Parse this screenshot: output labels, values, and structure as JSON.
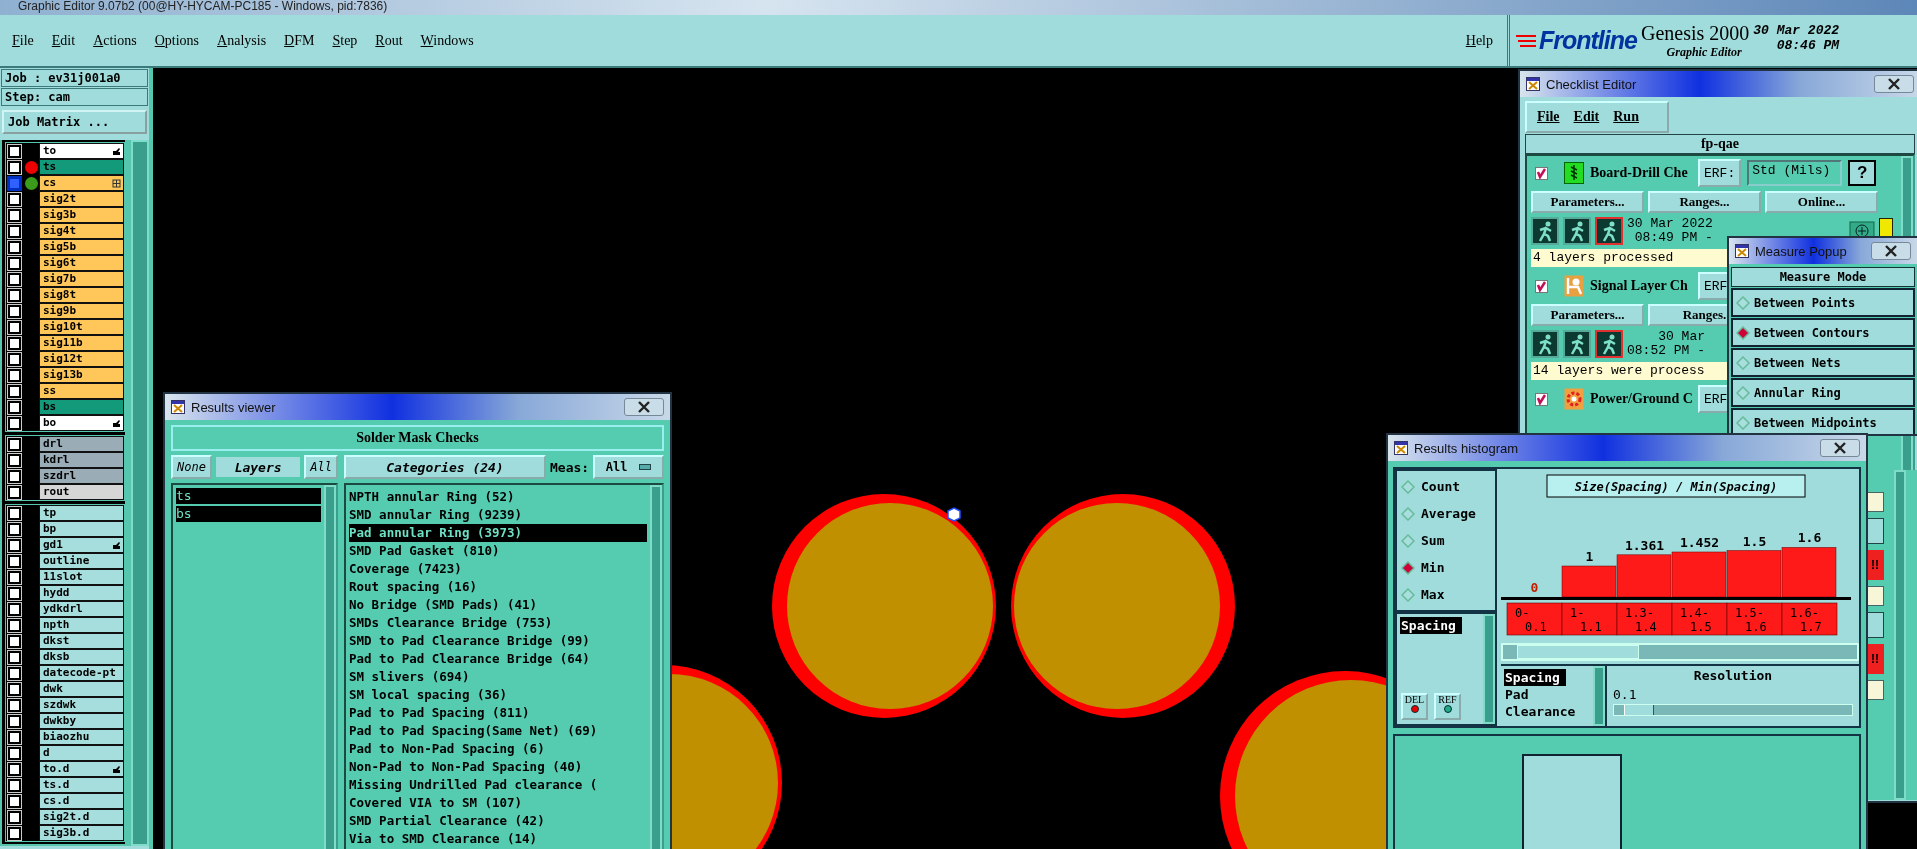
{
  "window": {
    "title": "Graphic Editor 9.07b2 (00@HY-HYCAM-PC185 - Windows, pid:7836)"
  },
  "menu_bar": {
    "items": [
      "File",
      "Edit",
      "Actions",
      "Options",
      "Analysis",
      "DFM",
      "Step",
      "Rout",
      "Windows"
    ],
    "help": "Help"
  },
  "brand": {
    "logo": "Frontline",
    "product": "Genesis 2000",
    "subtitle": "Graphic Editor",
    "date": "30 Mar 2022",
    "time": "08:46 PM"
  },
  "job_panel": {
    "job": "Job : ev31j001a0",
    "step": "Step: cam",
    "job_matrix_button": "Job Matrix ...",
    "layer_groups": [
      {
        "layers": [
          {
            "name": "to",
            "color": "#ffffff",
            "selected": false,
            "marker": {
              "kind": "pointer"
            }
          },
          {
            "name": "ts",
            "color": "#139a7a",
            "selected": false,
            "status_dot": {
              "color": "#ee0000"
            }
          },
          {
            "name": "cs",
            "color": "#ffc65a",
            "selected": true,
            "status_dot": {
              "color": "#3a9a1a"
            },
            "marker": {
              "kind": "grid"
            }
          },
          {
            "name": "sig2t",
            "color": "#ffc65a",
            "selected": false
          },
          {
            "name": "sig3b",
            "color": "#ffc65a",
            "selected": false
          },
          {
            "name": "sig4t",
            "color": "#ffc65a",
            "selected": false
          },
          {
            "name": "sig5b",
            "color": "#ffc65a",
            "selected": false
          },
          {
            "name": "sig6t",
            "color": "#ffc65a",
            "selected": false
          },
          {
            "name": "sig7b",
            "color": "#ffc65a",
            "selected": false
          },
          {
            "name": "sig8t",
            "color": "#ffc65a",
            "selected": false
          },
          {
            "name": "sig9b",
            "color": "#ffc65a",
            "selected": false
          },
          {
            "name": "sig10t",
            "color": "#ffc65a",
            "selected": false
          },
          {
            "name": "sig11b",
            "color": "#ffc65a",
            "selected": false
          },
          {
            "name": "sig12t",
            "color": "#ffc65a",
            "selected": false
          },
          {
            "name": "sig13b",
            "color": "#ffc65a",
            "selected": false
          },
          {
            "name": "ss",
            "color": "#ffc65a",
            "selected": false
          },
          {
            "name": "bs",
            "color": "#139a7a",
            "selected": false
          },
          {
            "name": "bo",
            "color": "#ffffff",
            "selected": false,
            "marker": {
              "kind": "pointer"
            }
          }
        ]
      },
      {
        "layers": [
          {
            "name": "drl",
            "color": "#9aacb6",
            "selected": false
          },
          {
            "name": "kdrl",
            "color": "#9aacb6",
            "selected": false
          },
          {
            "name": "szdrl",
            "color": "#9aacb6",
            "selected": false
          },
          {
            "name": "rout",
            "color": "#d6d6d6",
            "selected": false
          }
        ]
      },
      {
        "layers": [
          {
            "name": "tp",
            "color": "#a6dede",
            "selected": false
          },
          {
            "name": "bp",
            "color": "#a6dede",
            "selected": false
          },
          {
            "name": "gd1",
            "color": "#a6dede",
            "selected": false,
            "marker": {
              "kind": "pointer"
            }
          },
          {
            "name": "outline",
            "color": "#a6dede",
            "selected": false
          },
          {
            "name": "11slot",
            "color": "#a6dede",
            "selected": false
          },
          {
            "name": "hydd",
            "color": "#a6dede",
            "selected": false
          },
          {
            "name": "ydkdrl",
            "color": "#a6dede",
            "selected": false
          },
          {
            "name": "npth",
            "color": "#a6dede",
            "selected": false
          },
          {
            "name": "dkst",
            "color": "#a6dede",
            "selected": false
          },
          {
            "name": "dksb",
            "color": "#a6dede",
            "selected": false
          },
          {
            "name": "datecode-pt",
            "color": "#a6dede",
            "selected": false
          },
          {
            "name": "dwk",
            "color": "#a6dede",
            "selected": false
          },
          {
            "name": "szdwk",
            "color": "#a6dede",
            "selected": false
          },
          {
            "name": "dwkby",
            "color": "#a6dede",
            "selected": false
          },
          {
            "name": "biaozhu",
            "color": "#a6dede",
            "selected": false
          },
          {
            "name": "d",
            "color": "#a6dede",
            "selected": false
          },
          {
            "name": "to.d",
            "color": "#a6dede",
            "selected": false,
            "marker": {
              "kind": "pointer"
            }
          },
          {
            "name": "ts.d",
            "color": "#a6dede",
            "selected": false
          },
          {
            "name": "cs.d",
            "color": "#a6dede",
            "selected": false
          },
          {
            "name": "sig2t.d",
            "color": "#a6dede",
            "selected": false
          },
          {
            "name": "sig3b.d",
            "color": "#a6dede",
            "selected": false
          }
        ]
      }
    ]
  },
  "results_viewer": {
    "title": "Results viewer",
    "heading": "Solder Mask Checks",
    "none_button": "None",
    "layers_label": "Layers",
    "all_button": "All",
    "categories_label": "Categories (24)",
    "meas_label": "Meas:",
    "meas_value": "All",
    "layers": [
      {
        "name": "ts",
        "selected": true
      },
      {
        "name": "bs",
        "selected": true
      }
    ],
    "categories": [
      {
        "label": "NPTH annular Ring (52)",
        "selected": false
      },
      {
        "label": "SMD annular Ring (9239)",
        "selected": false
      },
      {
        "label": "Pad annular Ring (3973)",
        "selected": true
      },
      {
        "label": "SMD Pad Gasket (810)",
        "selected": false
      },
      {
        "label": "Coverage (7423)",
        "selected": false
      },
      {
        "label": "Rout spacing (16)",
        "selected": false
      },
      {
        "label": "No Bridge (SMD Pads) (41)",
        "selected": false
      },
      {
        "label": "SMDs Clearance Bridge (753)",
        "selected": false
      },
      {
        "label": "SMD to Pad Clearance Bridge (99)",
        "selected": false
      },
      {
        "label": "Pad to Pad Clearance Bridge (64)",
        "selected": false
      },
      {
        "label": "SM slivers (694)",
        "selected": false
      },
      {
        "label": "SM local spacing (36)",
        "selected": false
      },
      {
        "label": "Pad to Pad Spacing (811)",
        "selected": false
      },
      {
        "label": "Pad to Pad Spacing(Same Net) (69)",
        "selected": false
      },
      {
        "label": "Pad to Non-Pad Spacing (6)",
        "selected": false
      },
      {
        "label": "Non-Pad to Non-Pad Spacing (40)",
        "selected": false
      },
      {
        "label": "Missing Undrilled Pad clearance (",
        "selected": false
      },
      {
        "label": "Covered VIA to SM (107)",
        "selected": false
      },
      {
        "label": "SMD Partial Clearance (42)",
        "selected": false
      },
      {
        "label": "Via to SMD Clearance (14)",
        "selected": false
      }
    ]
  },
  "checklist_editor": {
    "title": "Checklist Editor",
    "menu": [
      "File",
      "Edit",
      "Run"
    ],
    "name": "fp-qae",
    "checks": [
      {
        "checked": true,
        "icon": {
          "kind": "drill"
        },
        "name": "Board-Drill Che",
        "erf_label": "ERF:",
        "erf_value": "Std (Mils)",
        "help": "?",
        "buttons": [
          "Parameters...",
          "Ranges...",
          "Online..."
        ],
        "date": "30 Mar 2022",
        "time": "08:49 PM -",
        "status": "4 layers processed"
      },
      {
        "checked": true,
        "icon": {
          "kind": "signal"
        },
        "name": "Signal Layer Ch",
        "erf_label": "ERF",
        "buttons": [
          "Parameters...",
          "Ranges."
        ],
        "date": "30 Mar",
        "time": "08:52 PM -",
        "status": "14 layers were process"
      },
      {
        "checked": true,
        "icon": {
          "kind": "power"
        },
        "name": "Power/Ground C",
        "erf_label": "ERF"
      }
    ],
    "side_flags": [
      "!!",
      "!!"
    ]
  },
  "measure_popup": {
    "title": "Measure Popup",
    "heading": "Measure Mode",
    "modes": [
      {
        "label": "Between Points",
        "selected": false
      },
      {
        "label": "Between Contours",
        "selected": true
      },
      {
        "label": "Between Nets",
        "selected": false
      },
      {
        "label": "Annular Ring",
        "selected": false
      },
      {
        "label": "Between Midpoints",
        "selected": false
      }
    ]
  },
  "results_histogram": {
    "title": "Results histogram",
    "functions": [
      {
        "label": "Count",
        "selected": false
      },
      {
        "label": "Average",
        "selected": false
      },
      {
        "label": "Sum",
        "selected": false
      },
      {
        "label": "Min",
        "selected": true
      },
      {
        "label": "Max",
        "selected": false
      }
    ],
    "fields": [
      {
        "label": "Spacing",
        "selected": true
      }
    ],
    "buttons": [
      {
        "label": "DEL",
        "kind": "delete"
      },
      {
        "label": "REF",
        "kind": "reference"
      }
    ],
    "chart_data": {
      "type": "bar",
      "title": "Size(Spacing) / Min(Spacing)",
      "categories": [
        "0-0.1",
        "1-1.1",
        "1.3-1.4",
        "1.4-1.5",
        "1.5-1.6",
        "1.6-1.7"
      ],
      "series": [
        {
          "color": "#ff1a1a",
          "values": [
            0,
            1,
            1.361,
            1.452,
            1.5,
            1.6
          ]
        }
      ],
      "data_labels": true,
      "value_labels": [
        "0",
        "1",
        "1.361",
        "1.452",
        "1.5",
        "1.6"
      ]
    },
    "measures": [
      {
        "label": "Spacing",
        "selected": true
      },
      {
        "label": "Pad",
        "selected": false
      },
      {
        "label": "Clearance",
        "selected": false
      }
    ],
    "resolution": {
      "label": "Resolution",
      "value": "0.1",
      "level": 0.04
    }
  }
}
